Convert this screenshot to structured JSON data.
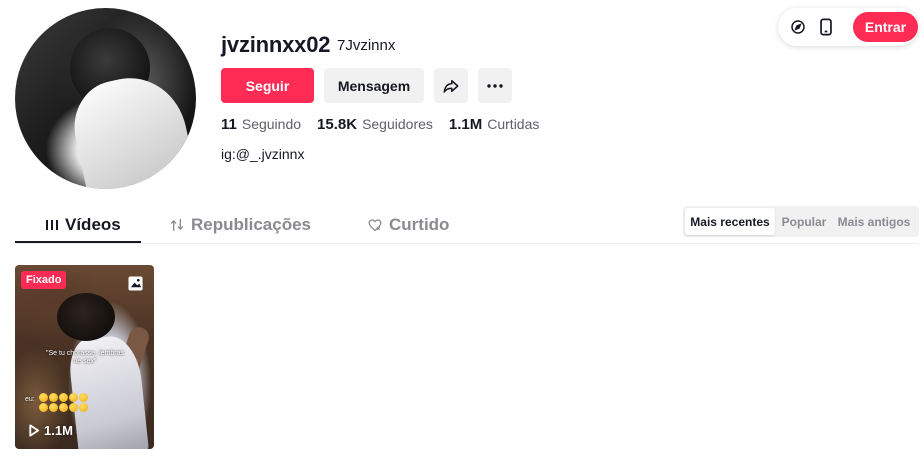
{
  "profile": {
    "username": "jvzinnxx02",
    "nickname": "7Jvzinnx",
    "bio": "ig:@_.jvzinnx"
  },
  "actions": {
    "follow_label": "Seguir",
    "message_label": "Mensagem"
  },
  "stats": [
    {
      "value": "11",
      "label": "Seguindo"
    },
    {
      "value": "15.8K",
      "label": "Seguidores"
    },
    {
      "value": "1.1M",
      "label": "Curtidas"
    }
  ],
  "topbar": {
    "login_label": "Entrar",
    "icons": [
      "compass-icon",
      "phone-icon"
    ]
  },
  "tabs": [
    {
      "label": "Vídeos",
      "icon": "grid-bars-icon",
      "active": true
    },
    {
      "label": "Republicações",
      "icon": "repost-icon",
      "active": false
    },
    {
      "label": "Curtido",
      "icon": "heart-icon",
      "active": false
    }
  ],
  "sort": {
    "options": [
      "Mais recentes",
      "Popular",
      "Mais antigos"
    ],
    "selected": "Mais recentes"
  },
  "videos": [
    {
      "badge": "Fixado",
      "views": "1.1M",
      "caption": "\"Se tu chorasse, lembras ne sex\"",
      "emoji_prefix": "eu:"
    }
  ],
  "colors": {
    "accent": "#fe2c55",
    "text": "#161823",
    "muted": "#8a8b91",
    "button_bg": "#f1f1f2"
  }
}
